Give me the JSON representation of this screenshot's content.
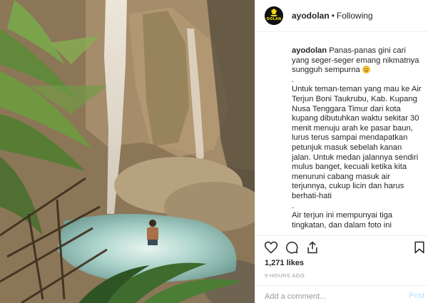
{
  "post": {
    "username": "ayodolan",
    "separator": "•",
    "follow_status": "Following",
    "avatar_text": "DOLAN",
    "caption": {
      "username": "ayodolan",
      "line1": "Panas-panas gini cari yang seger-seger emang nikmatnya sungguh sempurna",
      "dot": ".",
      "paragraph2": "Untuk teman-teman yang mau ke Air Terjun Boni Taukrubu, Kab. Kupang Nusa Tenggara Timur dari kota kupang dibutuhkan waktu sekitar 30 menit menuju arah ke pasar baun, lurus terus sampai mendapatkan petunjuk masuk sebelah kanan jalan. Untuk medan jalannya sendiri mulus banget, kecuali ketika kita menuruni cabang masuk air terjunnya, cukup licin dan harus berhati-hati",
      "dot2": ".",
      "paragraph3": "Air terjun ini mempunyai tiga tingkatan, dan dalam foto ini"
    },
    "likes": "1,271 likes",
    "time": "9 HOURS AGO",
    "comment_placeholder": "Add a comment...",
    "post_label": "Post"
  },
  "icons": {
    "like": "heart-icon",
    "comment": "comment-icon",
    "share": "share-icon",
    "save": "bookmark-icon",
    "caption_emoji": "smiling-face-emoji"
  },
  "colors": {
    "text": "#262626",
    "muted": "#999999",
    "border": "#efefef",
    "post_button_disabled": "#b2dffc",
    "avatar_accent": "#f5d90a"
  }
}
